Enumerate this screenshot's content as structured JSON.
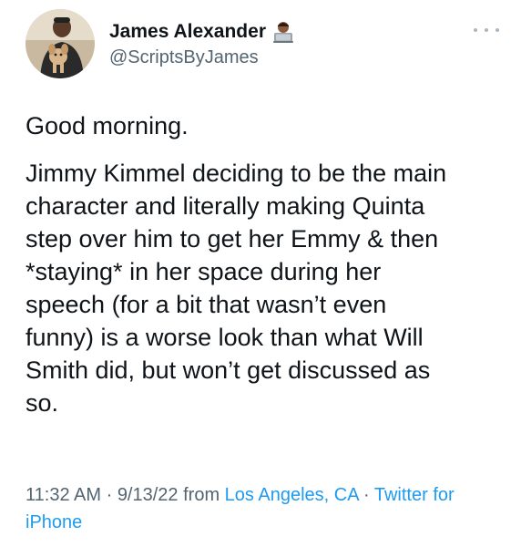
{
  "author": {
    "name": "James Alexander",
    "handle": "@ScriptsByJames",
    "avatar_icon": "avatar-man-with-dog",
    "name_emoji_icon": "technologist-laptop-icon"
  },
  "tweet": {
    "line1": "Good morning.",
    "body": "Jimmy Kimmel deciding to be the main\ncharacter and literally making Quinta\nstep over him to get her Emmy & then\n*staying* in her space during her\nspeech (for a bit that wasn’t even\nfunny) is a worse look than what Will\nSmith did, but won’t get discussed as\nso."
  },
  "meta": {
    "time": "11:32 AM",
    "sep1": " · ",
    "date": "9/13/22",
    "from": " from ",
    "location": "Los Angeles, CA",
    "sep2": " · ",
    "source": "Twitter for iPhone"
  },
  "colors": {
    "text": "#0f1419",
    "secondary": "#536471",
    "link": "#1d9bf0"
  }
}
